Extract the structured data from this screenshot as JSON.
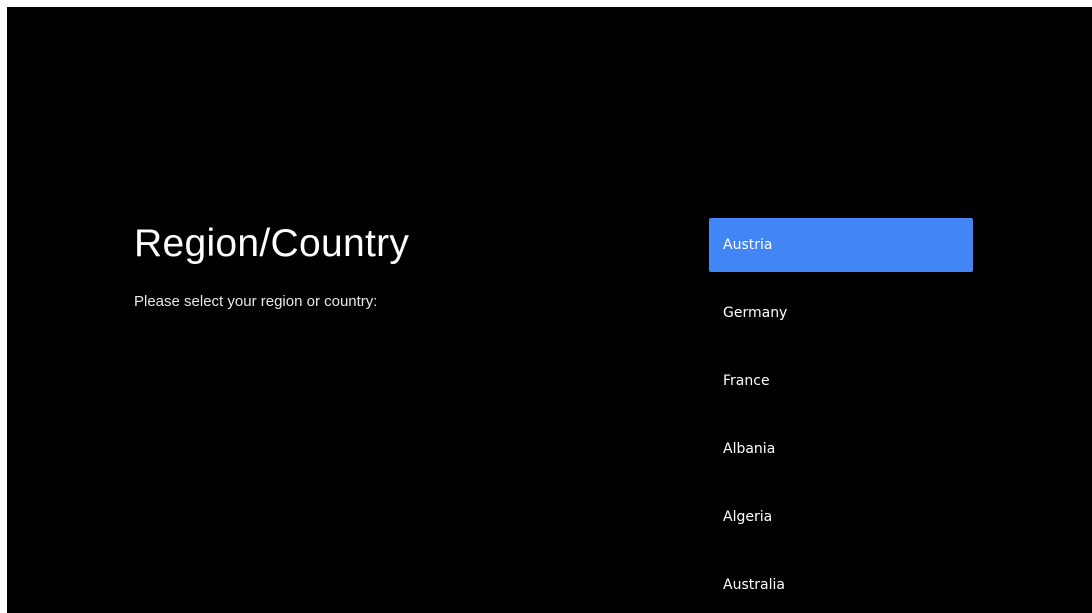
{
  "header": {
    "title": "Region/Country",
    "subtitle": "Please select your region or country:"
  },
  "countries": [
    {
      "label": "Austria",
      "selected": true
    },
    {
      "label": "Germany",
      "selected": false
    },
    {
      "label": "France",
      "selected": false
    },
    {
      "label": "Albania",
      "selected": false
    },
    {
      "label": "Algeria",
      "selected": false
    },
    {
      "label": "Australia",
      "selected": false
    }
  ],
  "colors": {
    "background": "#000000",
    "selection": "#4285f4",
    "text": "#ffffff"
  }
}
